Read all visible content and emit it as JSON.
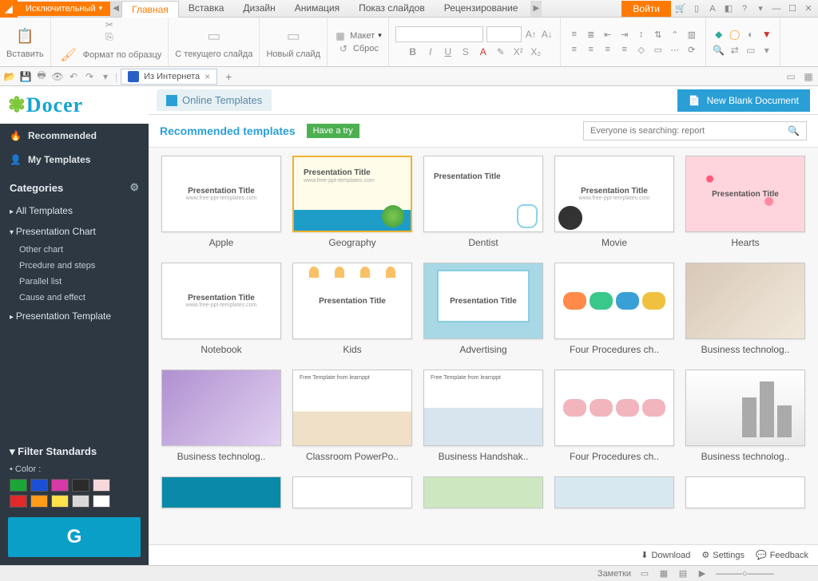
{
  "menubar": {
    "exclusive": "Исключительный",
    "tabs": [
      "Главная",
      "Вставка",
      "Дизайн",
      "Анимация",
      "Показ слайдов",
      "Рецензирование"
    ],
    "active_tab": 0,
    "login": "Войти"
  },
  "ribbon": {
    "paste": "Вставить",
    "format_painter": "Формат по образцу",
    "from_current": "С текущего слайда",
    "new_slide": "Новый слайд",
    "layout": "Макет",
    "reset": "Сброс"
  },
  "qa": {
    "doc_tab": "Из Интернета"
  },
  "sidebar": {
    "recommended": "Recommended",
    "my_templates": "My Templates",
    "categories": "Categories",
    "tree": {
      "all": "All Templates",
      "chart": "Presentation Chart",
      "subs": [
        "Other chart",
        "Prcedure and steps",
        "Parallel list",
        "Cause and effect"
      ],
      "template": "Presentation Template"
    },
    "filter": "Filter Standards",
    "color_label": "Color :",
    "swatches": [
      "#1aa637",
      "#1a4fd6",
      "#d63aa6",
      "#2b2b2b",
      "#f6d7da",
      "#e02a2a",
      "#ff9a1a",
      "#ffe14a",
      "#d8d8d8",
      "#ffffff"
    ]
  },
  "content": {
    "online_templates": "Online Templates",
    "new_blank": "New Blank Document",
    "recommended_title": "Recommended templates",
    "have_a_try": "Have a try",
    "search_placeholder": "Everyone is searching: report",
    "templates": [
      {
        "label": "Apple",
        "kind": "apple"
      },
      {
        "label": "Geography",
        "kind": "geo",
        "selected": true
      },
      {
        "label": "Dentist",
        "kind": "dentist"
      },
      {
        "label": "Movie",
        "kind": "movie"
      },
      {
        "label": "Hearts",
        "kind": "hearts"
      },
      {
        "label": "Notebook",
        "kind": "plain"
      },
      {
        "label": "Kids",
        "kind": "kids"
      },
      {
        "label": "Advertising",
        "kind": "adv"
      },
      {
        "label": "Four Procedures ch..",
        "kind": "proc"
      },
      {
        "label": "Business technolog..",
        "kind": "biz"
      },
      {
        "label": "Business technolog..",
        "kind": "tech"
      },
      {
        "label": "Classroom PowerPo..",
        "kind": "class"
      },
      {
        "label": "Business Handshak..",
        "kind": "hand"
      },
      {
        "label": "Four Procedures ch..",
        "kind": "proc2"
      },
      {
        "label": "Business technolog..",
        "kind": "bldg"
      }
    ],
    "footer": {
      "download": "Download",
      "settings": "Settings",
      "feedback": "Feedback"
    }
  },
  "statusbar": {
    "notes": "Заметки"
  }
}
